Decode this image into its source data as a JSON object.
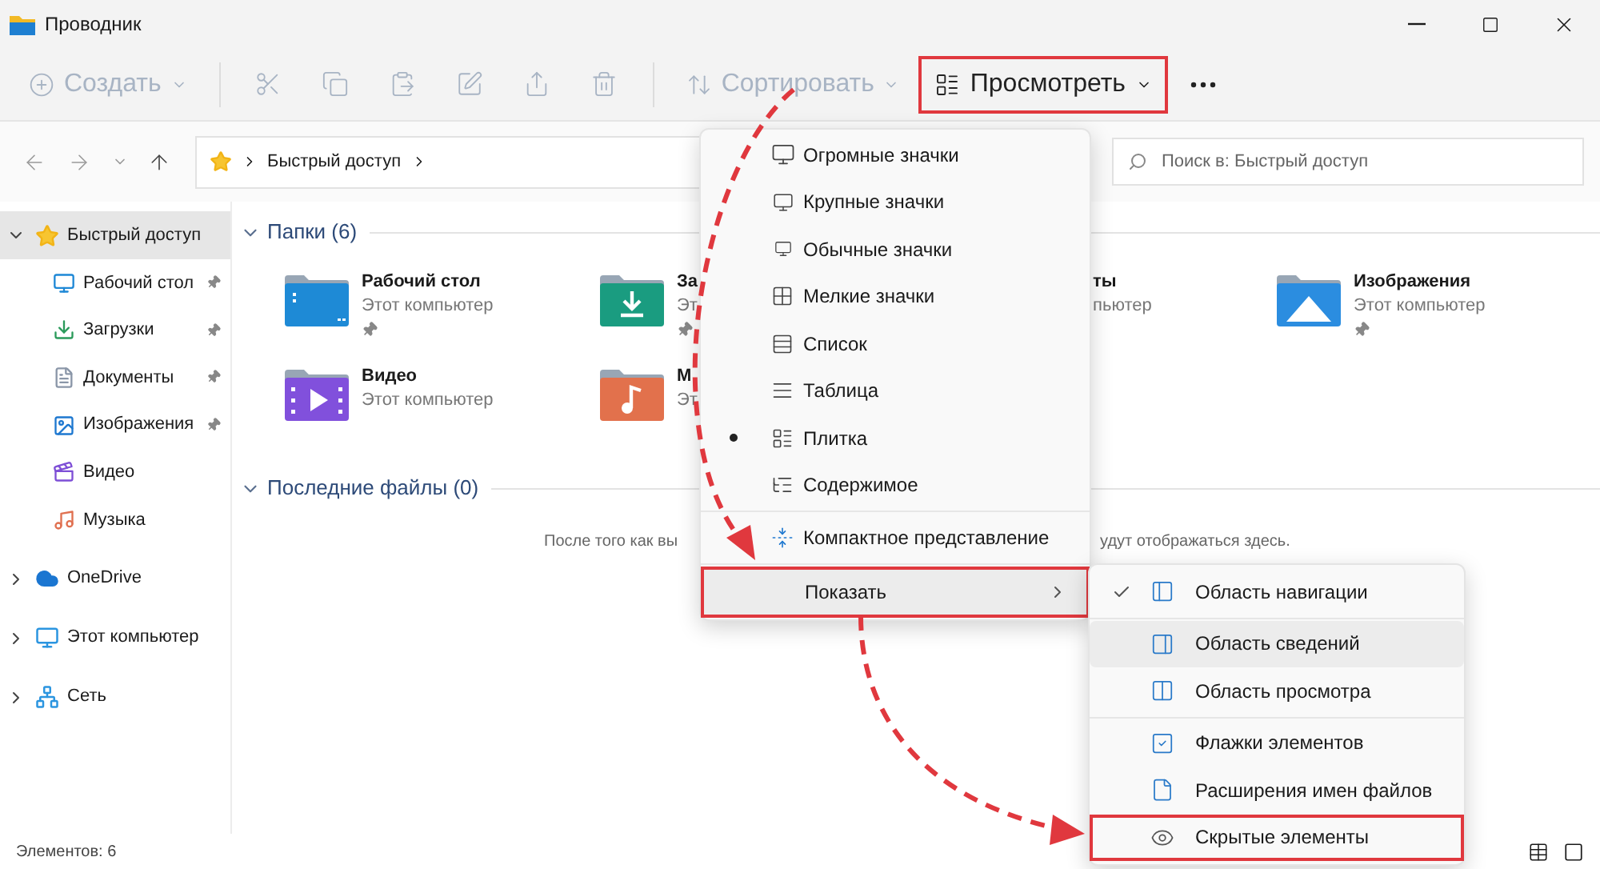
{
  "window": {
    "title": "Проводник"
  },
  "toolbar": {
    "groups": [
      [
        {
          "kind": "labeled",
          "label": "Создать",
          "disabled": true,
          "emphasized": false
        }
      ],
      [
        {
          "kind": "icon",
          "disabled": true
        },
        {
          "kind": "icon",
          "disabled": true
        },
        {
          "kind": "icon",
          "disabled": true
        },
        {
          "kind": "icon",
          "disabled": true
        },
        {
          "kind": "icon",
          "disabled": true
        },
        {
          "kind": "icon",
          "disabled": true
        }
      ],
      [
        {
          "kind": "labeled",
          "label": "Сортировать",
          "disabled": true,
          "emphasized": false
        },
        {
          "kind": "labeled",
          "label": "Просмотреть",
          "disabled": false,
          "emphasized": true
        },
        {
          "kind": "icon",
          "disabled": false
        }
      ]
    ]
  },
  "address": {
    "crumbs": [
      "Быстрый доступ"
    ]
  },
  "search": {
    "placeholder": "Поиск в: Быстрый доступ"
  },
  "sidebar": {
    "items": [
      {
        "label": "Быстрый доступ",
        "selected": true,
        "expanded": true,
        "children": [
          {
            "label": "Рабочий стол",
            "selected": false,
            "pinned": true
          },
          {
            "label": "Загрузки",
            "selected": false,
            "pinned": true
          },
          {
            "label": "Документы",
            "selected": false,
            "pinned": true
          },
          {
            "label": "Изображения",
            "selected": false,
            "pinned": true
          },
          {
            "label": "Видео",
            "selected": false,
            "pinned": false
          },
          {
            "label": "Музыка",
            "selected": false,
            "pinned": false
          }
        ]
      },
      {
        "label": "OneDrive",
        "selected": false,
        "expanded": false
      },
      {
        "label": "Этот компьютер",
        "selected": false,
        "expanded": false
      },
      {
        "label": "Сеть",
        "selected": false,
        "expanded": false
      }
    ]
  },
  "sections": [
    {
      "title": "Папки (6)",
      "expanded": true,
      "folders": [
        {
          "kind": "full",
          "name": "Рабочий стол",
          "location": "Этот компьютер",
          "pinned": true,
          "color": "#1e8ad6"
        },
        {
          "kind": "full",
          "name": "За",
          "location": "Эт",
          "pinned": true,
          "color": "#1a9c80"
        },
        {
          "kind": "tail",
          "name": "ты",
          "location": "пьютер"
        },
        {
          "kind": "full",
          "name": "Изображения",
          "location": "Этот компьютер",
          "pinned": true,
          "color": "#2b8de0"
        },
        {
          "kind": "full",
          "name": "Видео",
          "location": "Этот компьютер",
          "pinned": false,
          "color": "#8150dc"
        },
        {
          "kind": "full",
          "name": "М",
          "location": "Эт",
          "pinned": false,
          "color": "#e2714c"
        }
      ]
    },
    {
      "title": "Последние файлы (0)",
      "expanded": true,
      "empty_text": [
        "После того как вы",
        "удут отображаться здесь."
      ]
    }
  ],
  "view_menu": {
    "sections": [
      [
        {
          "kind": "option",
          "label": "Огромные значки",
          "selected": false,
          "highlighted": false,
          "emphasized": false
        },
        {
          "kind": "option",
          "label": "Крупные значки",
          "selected": false,
          "highlighted": false,
          "emphasized": false
        },
        {
          "kind": "option",
          "label": "Обычные значки",
          "selected": false,
          "highlighted": false,
          "emphasized": false
        },
        {
          "kind": "option",
          "label": "Мелкие значки",
          "selected": false,
          "highlighted": false,
          "emphasized": false
        },
        {
          "kind": "option",
          "label": "Список",
          "selected": false,
          "highlighted": false,
          "emphasized": false
        },
        {
          "kind": "option",
          "label": "Таблица",
          "selected": false,
          "highlighted": false,
          "emphasized": false
        },
        {
          "kind": "option",
          "label": "Плитка",
          "selected": true,
          "highlighted": false,
          "emphasized": false
        },
        {
          "kind": "option",
          "label": "Содержимое",
          "selected": false,
          "highlighted": false,
          "emphasized": false
        }
      ],
      [
        {
          "kind": "toggle",
          "label": "Компактное представление",
          "checked": false,
          "highlighted": false,
          "emphasized": false
        }
      ],
      [
        {
          "kind": "submenu",
          "label": "Показать",
          "highlighted": true,
          "emphasized": true
        }
      ]
    ]
  },
  "show_menu": {
    "sections": [
      [
        {
          "label": "Область навигации",
          "checked": true,
          "highlighted": false,
          "emphasized": false
        }
      ],
      [
        {
          "label": "Область сведений",
          "checked": false,
          "highlighted": true,
          "emphasized": false
        },
        {
          "label": "Область просмотра",
          "checked": false,
          "highlighted": false,
          "emphasized": false
        }
      ],
      [
        {
          "label": "Флажки элементов",
          "checked": false,
          "highlighted": false,
          "emphasized": false
        },
        {
          "label": "Расширения имен файлов",
          "checked": false,
          "highlighted": false,
          "emphasized": false
        },
        {
          "label": "Скрытые элементы",
          "checked": false,
          "highlighted": false,
          "emphasized": true
        }
      ]
    ]
  },
  "status_bar": {
    "count": "Элементов: 6"
  }
}
